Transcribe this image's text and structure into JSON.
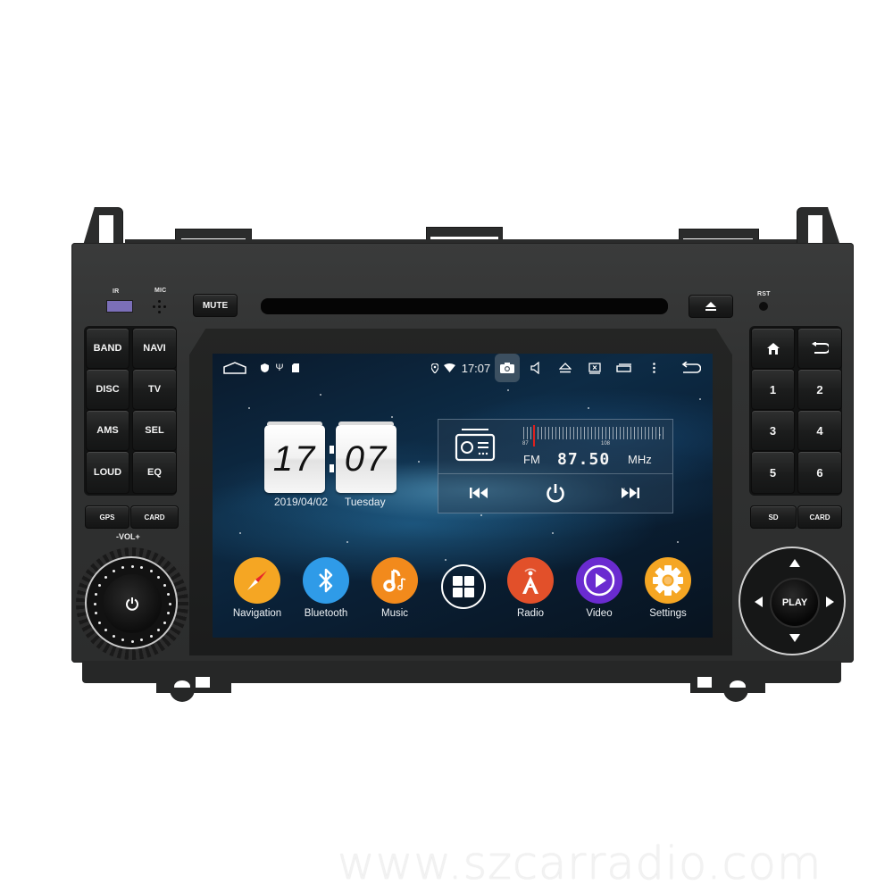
{
  "device": {
    "labels": {
      "ir": "IR",
      "mic": "MIC",
      "rst": "RST",
      "vol": "-VOL+"
    },
    "top_buttons": {
      "mute": "MUTE",
      "eject_icon": "eject-icon"
    },
    "left_buttons": [
      {
        "label": "BAND"
      },
      {
        "label": "NAVI"
      },
      {
        "label": "DISC"
      },
      {
        "label": "TV"
      },
      {
        "label": "AMS"
      },
      {
        "label": "SEL"
      },
      {
        "label": "LOUD"
      },
      {
        "label": "EQ"
      }
    ],
    "left_small_buttons": [
      {
        "label": "GPS"
      },
      {
        "label": "CARD"
      }
    ],
    "right_buttons": [
      {
        "icon": "home-icon"
      },
      {
        "icon": "back-icon"
      },
      {
        "label": "1"
      },
      {
        "label": "2"
      },
      {
        "label": "3"
      },
      {
        "label": "4"
      },
      {
        "label": "5"
      },
      {
        "label": "6"
      }
    ],
    "right_small_buttons": [
      {
        "label": "SD"
      },
      {
        "label": "CARD"
      }
    ],
    "dpad": {
      "center": "PLAY"
    },
    "knob": {
      "icon": "power-icon"
    }
  },
  "screen": {
    "status_bar": {
      "left_icons": [
        "home-outline-icon",
        "shield-icon",
        "usb-icon",
        "sd-card-icon"
      ],
      "time": "17:07",
      "right_icons": [
        "location-icon",
        "wifi-icon",
        "camera-icon",
        "volume-icon",
        "eject-icon",
        "screen-off-icon",
        "recent-apps-icon",
        "more-icon",
        "back-icon"
      ]
    },
    "clock": {
      "hours": "17",
      "minutes": "07",
      "date": "2019/04/02",
      "weekday": "Tuesday"
    },
    "radio": {
      "band": "FM",
      "frequency": "87.50",
      "unit": "MHz",
      "scale_min": "87",
      "scale_max": "108"
    },
    "apps": [
      {
        "label": "Navigation",
        "color": "#f5a623"
      },
      {
        "label": "Bluetooth",
        "color": "#2f9be8"
      },
      {
        "label": "Music",
        "color": "#f28a1c"
      },
      {
        "label": "",
        "color": "transparent"
      },
      {
        "label": "Radio",
        "color": "#e2502a"
      },
      {
        "label": "Video",
        "color": "#6a2bd0"
      },
      {
        "label": "Settings",
        "color": "#f5a623"
      }
    ]
  },
  "watermark": "www.szcarradio.com"
}
